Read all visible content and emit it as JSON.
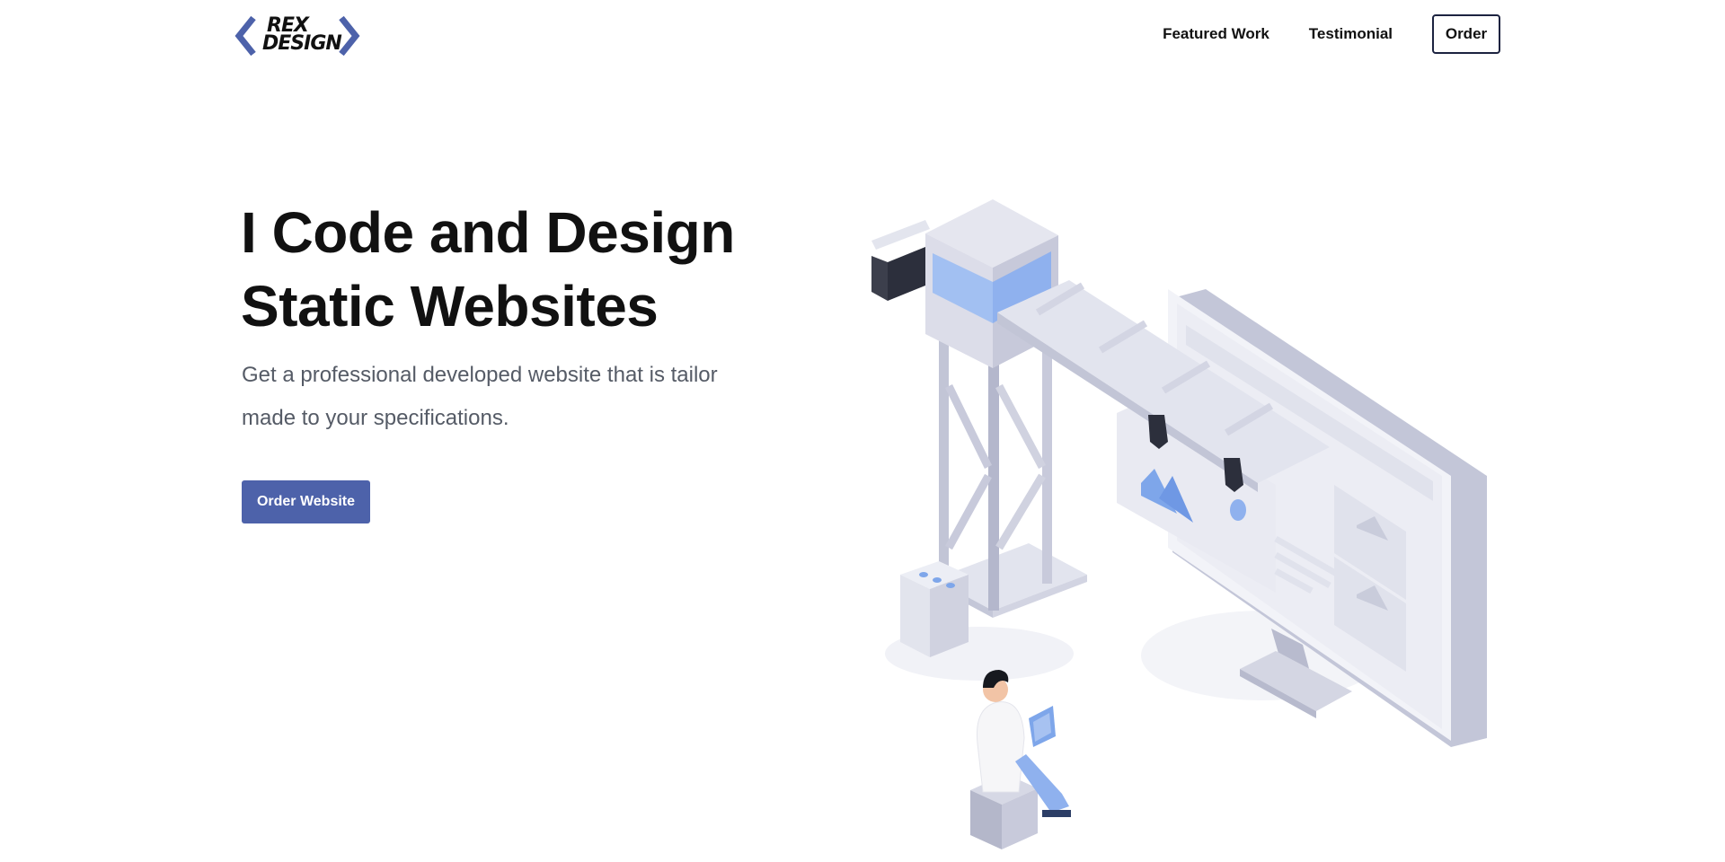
{
  "brand": {
    "logo_line1": "REX",
    "logo_line2": "DESIGN",
    "logo_icon": "chevron-brackets-icon",
    "accent_color": "#4d62aa"
  },
  "nav": {
    "featured_work": "Featured Work",
    "testimonial": "Testimonial",
    "order": "Order"
  },
  "hero": {
    "title_line1": "I Code and Design",
    "title_line2": "Static Websites",
    "subtitle_line1": "Get a professional developed website that is tailor",
    "subtitle_line2": "made to your specifications.",
    "cta_label": "Order Website",
    "illustration": "crane-building-website-illustration"
  }
}
